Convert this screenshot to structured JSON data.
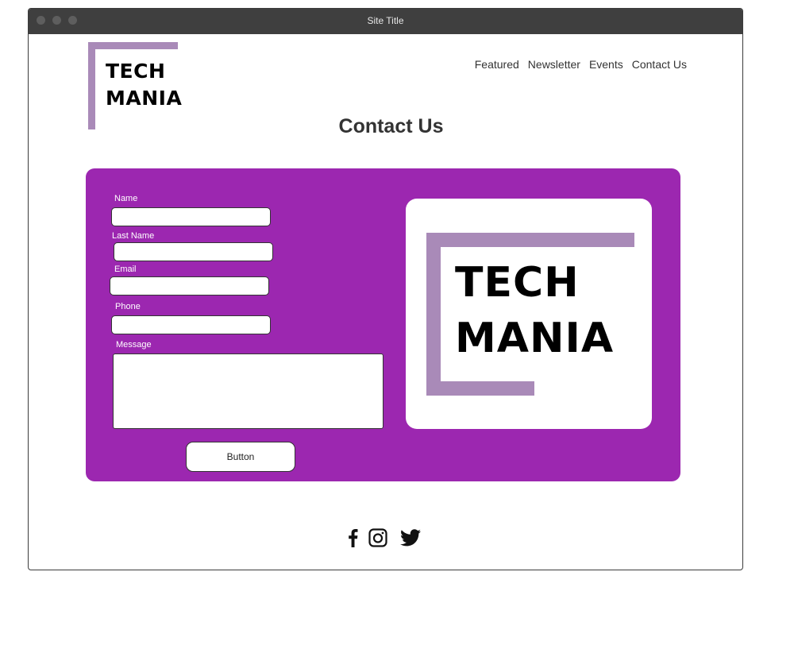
{
  "window": {
    "title": "Site Title"
  },
  "logo": {
    "line1": "TECH",
    "line2": "MANIA"
  },
  "nav": {
    "items": [
      {
        "label": "Featured"
      },
      {
        "label": "Newsletter"
      },
      {
        "label": "Events"
      },
      {
        "label": "Contact Us"
      }
    ]
  },
  "page": {
    "title": "Contact Us"
  },
  "form": {
    "name_label": "Name",
    "lastname_label": "Last Name",
    "email_label": "Email",
    "phone_label": "Phone",
    "message_label": "Message",
    "submit_label": "Button"
  },
  "social": {
    "icons": [
      "facebook-icon",
      "instagram-icon",
      "twitter-icon"
    ]
  },
  "colors": {
    "panel": "#9c27b0",
    "logo_bracket": "#a98ab8",
    "titlebar": "#3f3f3f"
  }
}
